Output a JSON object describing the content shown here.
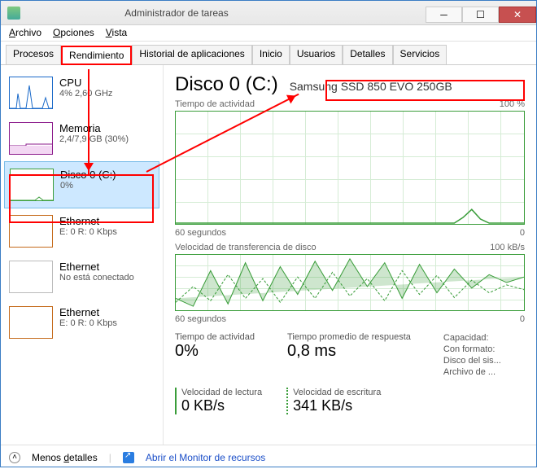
{
  "window": {
    "title": "Administrador de tareas"
  },
  "menu": {
    "archivo": "Archivo",
    "opciones": "Opciones",
    "vista": "Vista"
  },
  "tabs": {
    "procesos": "Procesos",
    "rendimiento": "Rendimiento",
    "historial": "Historial de aplicaciones",
    "inicio": "Inicio",
    "usuarios": "Usuarios",
    "detalles": "Detalles",
    "servicios": "Servicios"
  },
  "sidebar": [
    {
      "label": "CPU",
      "sub": "4% 2,60 GHz",
      "kind": "cpu"
    },
    {
      "label": "Memoria",
      "sub": "2,4/7,9 GB (30%)",
      "kind": "mem"
    },
    {
      "label": "Disco 0 (C:)",
      "sub": "0%",
      "kind": "disk",
      "selected": true
    },
    {
      "label": "Ethernet",
      "sub": "E: 0 R: 0 Kbps",
      "kind": "eth"
    },
    {
      "label": "Ethernet",
      "sub": "No está conectado",
      "kind": "eth2"
    },
    {
      "label": "Ethernet",
      "sub": "E: 0 R: 0 Kbps",
      "kind": "eth"
    }
  ],
  "main": {
    "title": "Disco 0 (C:)",
    "device": "Samsung SSD 850 EVO 250GB",
    "chart1_label": "Tiempo de actividad",
    "chart1_right": "100 %",
    "chart1_xleft": "60 segundos",
    "chart1_xright": "0",
    "chart2_label": "Velocidad de transferencia de disco",
    "chart2_right": "100 kB/s",
    "chart2_xleft": "60 segundos",
    "chart2_xright": "0",
    "stat_active_label": "Tiempo de actividad",
    "stat_active_value": "0%",
    "stat_resp_label": "Tiempo promedio de respuesta",
    "stat_resp_value": "0,8 ms",
    "stat_cap_labels": [
      "Capacidad:",
      "Con formato:",
      "Disco del sis...",
      "Archivo de ..."
    ],
    "read_label": "Velocidad de lectura",
    "read_value": "0 KB/s",
    "write_label": "Velocidad de escritura",
    "write_value": "341 KB/s"
  },
  "footer": {
    "less": "Menos detalles",
    "resmon": "Abrir el Monitor de recursos"
  },
  "chart_data": {
    "type": "line",
    "title": "Disco 0 (C:) — Tiempo de actividad",
    "xlabel": "segundos",
    "ylabel": "%",
    "xlim": [
      60,
      0
    ],
    "ylim": [
      0,
      100
    ],
    "series": [
      {
        "name": "Tiempo de actividad (%)",
        "x": [
          60,
          55,
          50,
          45,
          40,
          35,
          30,
          25,
          20,
          15,
          10,
          8,
          6,
          4,
          2,
          0
        ],
        "values": [
          0,
          0,
          0,
          0,
          0,
          0,
          0,
          0,
          0,
          0,
          0,
          5,
          12,
          4,
          0,
          0
        ]
      }
    ],
    "secondary": {
      "title": "Velocidad de transferencia de disco",
      "ylabel": "kB/s",
      "ylim": [
        0,
        100
      ],
      "series": [
        {
          "name": "Lectura (kB/s)",
          "x": [
            60,
            55,
            50,
            45,
            40,
            35,
            30,
            25,
            20,
            15,
            10,
            5,
            0
          ],
          "values": [
            20,
            5,
            60,
            10,
            80,
            15,
            70,
            30,
            90,
            40,
            85,
            25,
            60
          ]
        },
        {
          "name": "Escritura (kB/s)",
          "x": [
            60,
            55,
            50,
            45,
            40,
            35,
            30,
            25,
            20,
            15,
            10,
            5,
            0
          ],
          "values": [
            10,
            40,
            20,
            70,
            25,
            60,
            20,
            55,
            30,
            65,
            35,
            50,
            40
          ]
        }
      ]
    }
  }
}
